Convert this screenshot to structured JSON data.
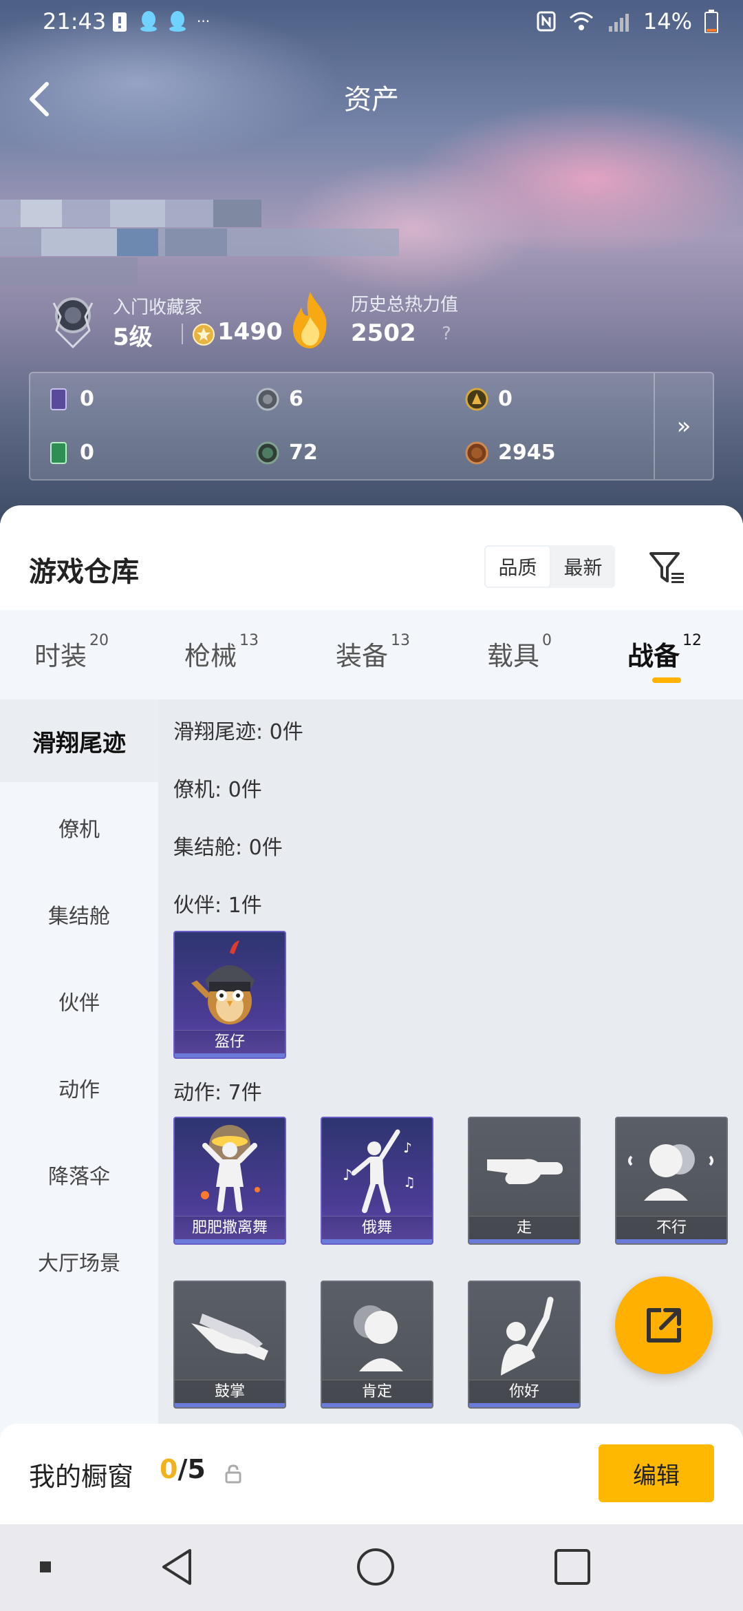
{
  "status_bar": {
    "time": "21:43",
    "more": "···",
    "battery_percent": "14%"
  },
  "header": {
    "title": "资产"
  },
  "profile": {
    "rank_title": "入门收藏家",
    "level": "5级",
    "points": "1490",
    "heat_title": "历史总热力值",
    "heat_value": "2502",
    "heat_help": "?"
  },
  "currencies": [
    {
      "icon": "card-icon",
      "value": "0",
      "color": "#5a4a9c"
    },
    {
      "icon": "silver-coin-icon",
      "value": "6",
      "color": "#8a8f96"
    },
    {
      "icon": "gold-token-icon",
      "value": "0",
      "color": "#c59a2c"
    },
    {
      "icon": "green-card-icon",
      "value": "0",
      "color": "#2f8f53"
    },
    {
      "icon": "green-gem-icon",
      "value": "72",
      "color": "#4c7d62"
    },
    {
      "icon": "bronze-coin-icon",
      "value": "2945",
      "color": "#a05b2a"
    }
  ],
  "currency_more": "»",
  "warehouse": {
    "title": "游戏仓库",
    "sort_options": [
      "品质",
      "最新"
    ],
    "active_sort": "品质"
  },
  "tabs": [
    {
      "label": "时装",
      "count": "20"
    },
    {
      "label": "枪械",
      "count": "13"
    },
    {
      "label": "装备",
      "count": "13"
    },
    {
      "label": "载具",
      "count": "0"
    },
    {
      "label": "战备",
      "count": "12"
    }
  ],
  "active_tab": "战备",
  "sidebar": {
    "items": [
      {
        "label": "滑翔尾迹"
      },
      {
        "label": "僚机"
      },
      {
        "label": "集结舱"
      },
      {
        "label": "伙伴"
      },
      {
        "label": "动作"
      },
      {
        "label": "降落伞"
      },
      {
        "label": "大厅场景"
      }
    ],
    "active": "滑翔尾迹"
  },
  "groups": {
    "trail": "滑翔尾迹: 0件",
    "wingman": "僚机: 0件",
    "pod": "集结舱: 0件",
    "partner": "伙伴: 1件",
    "action": "动作: 7件"
  },
  "partner_items": [
    {
      "name": "盔仔"
    }
  ],
  "action_items": [
    {
      "name": "肥肥撒离舞"
    },
    {
      "name": "俄舞"
    },
    {
      "name": "走"
    },
    {
      "name": "不行"
    },
    {
      "name": "鼓掌"
    },
    {
      "name": "肯定"
    },
    {
      "name": "你好"
    }
  ],
  "showcase": {
    "title": "我的橱窗",
    "used": "0",
    "separator": "/",
    "total": "5",
    "edit_label": "编辑"
  },
  "accent_color": "#ffb300"
}
